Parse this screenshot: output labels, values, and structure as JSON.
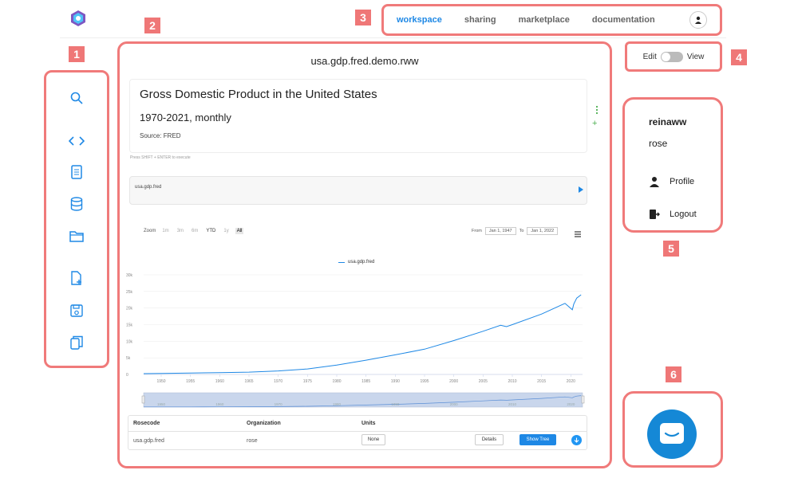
{
  "header": {
    "nav": [
      {
        "label": "workspace",
        "active": true
      },
      {
        "label": "sharing"
      },
      {
        "label": "marketplace"
      },
      {
        "label": "documentation"
      }
    ]
  },
  "badges": [
    "1",
    "2",
    "3",
    "4",
    "5",
    "6"
  ],
  "sidebar": {
    "icons": [
      "search-icon",
      "code-icon",
      "document-icon",
      "database-icon",
      "folder-icon",
      "new-file-icon",
      "save-icon",
      "copy-icon"
    ]
  },
  "main": {
    "file_title": "usa.gdp.fred.demo.rww",
    "markdown": {
      "title": "Gross Domestic Product in the United States",
      "subtitle": "1970-2021, monthly",
      "source": "Source: FRED"
    },
    "hint": "Press SHIFT + ENTER to execute",
    "code": "usa.gdp.fred",
    "zoom": {
      "label": "Zoom",
      "buttons": [
        "1m",
        "3m",
        "6m",
        "YTD",
        "1y",
        "All"
      ],
      "from_label": "From",
      "from_value": "Jan 1, 1947",
      "to_label": "To",
      "to_value": "Jan 1, 2022"
    },
    "table": {
      "headers": [
        "Rosecode",
        "Organization",
        "Units"
      ],
      "row": {
        "rosecode": "usa.gdp.fred",
        "organization": "rose",
        "units": "None",
        "details": "Details",
        "show_tree": "Show Tree"
      }
    }
  },
  "toggle": {
    "edit": "Edit",
    "view": "View"
  },
  "user_menu": {
    "username": "reinaww",
    "org": "rose",
    "profile": "Profile",
    "logout": "Logout"
  },
  "colors": {
    "accent": "#1e88e5",
    "annotation": "#f07a7a",
    "chat": "#1588d6"
  },
  "chart_data": {
    "type": "line",
    "series": [
      {
        "name": "usa.gdp.fred"
      }
    ],
    "x": [
      1947,
      1950,
      1955,
      1960,
      1965,
      1970,
      1975,
      1980,
      1985,
      1990,
      1995,
      2000,
      2005,
      2008,
      2009,
      2010,
      2015,
      2019,
      2020.25,
      2020.5,
      2021,
      2021.75
    ],
    "y": [
      0.25,
      0.3,
      0.4,
      0.55,
      0.7,
      1.05,
      1.65,
      2.8,
      4.3,
      5.9,
      7.6,
      10.2,
      13.0,
      14.8,
      14.4,
      15.0,
      18.2,
      21.4,
      19.5,
      21.2,
      23.0,
      24.0
    ],
    "yticks": [
      "0",
      "5k",
      "10k",
      "15k",
      "20k",
      "25k",
      "30k"
    ],
    "xticks": [
      "1950",
      "1955",
      "1960",
      "1965",
      "1970",
      "1975",
      "1980",
      "1985",
      "1990",
      "1995",
      "2000",
      "2005",
      "2010",
      "2015",
      "2020"
    ],
    "navigator_ticks": [
      "1950",
      "1960",
      "1970",
      "1980",
      "1990",
      "2000",
      "2010",
      "2020"
    ],
    "xlim": [
      1947,
      2022
    ],
    "ylim": [
      0,
      30000
    ],
    "legend": "top-center"
  }
}
